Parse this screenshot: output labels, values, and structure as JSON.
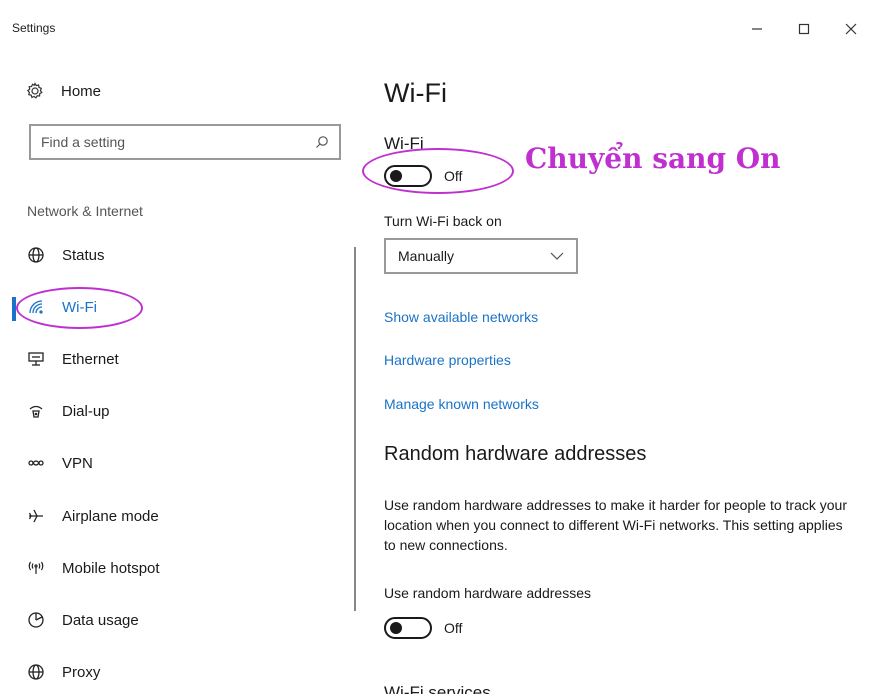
{
  "window": {
    "title": "Settings",
    "minimize_icon": "minimize-icon",
    "maximize_icon": "maximize-icon",
    "close_icon": "close-icon"
  },
  "sidebar": {
    "home_label": "Home",
    "search_placeholder": "Find a setting",
    "section_label": "Network & Internet",
    "items": [
      {
        "label": "Status",
        "icon": "globe-icon"
      },
      {
        "label": "Wi-Fi",
        "icon": "wifi-icon",
        "active": true
      },
      {
        "label": "Ethernet",
        "icon": "ethernet-icon"
      },
      {
        "label": "Dial-up",
        "icon": "dialup-icon"
      },
      {
        "label": "VPN",
        "icon": "vpn-icon"
      },
      {
        "label": "Airplane mode",
        "icon": "airplane-icon"
      },
      {
        "label": "Mobile hotspot",
        "icon": "hotspot-icon"
      },
      {
        "label": "Data usage",
        "icon": "data-usage-icon"
      },
      {
        "label": "Proxy",
        "icon": "proxy-icon"
      }
    ]
  },
  "main": {
    "title": "Wi-Fi",
    "wifi_label": "Wi-Fi",
    "wifi_state": "Off",
    "annotation": "Chuyển sang On",
    "turn_back_label": "Turn Wi-Fi back on",
    "turn_back_value": "Manually",
    "links": [
      "Show available networks",
      "Hardware properties",
      "Manage known networks"
    ],
    "random_heading": "Random hardware addresses",
    "random_desc": "Use random hardware addresses to make it harder for people to track your location when you connect to different Wi-Fi networks. This setting applies to new connections.",
    "random_label": "Use random hardware addresses",
    "random_state": "Off",
    "services_heading": "Wi-Fi services"
  },
  "colors": {
    "accent": "#1a73c8",
    "annotation": "#c030d0"
  }
}
